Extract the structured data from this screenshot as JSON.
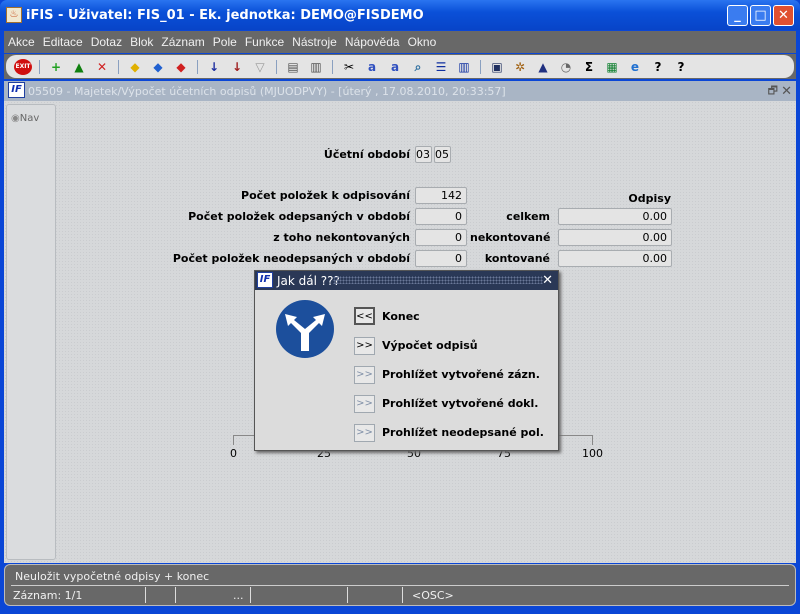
{
  "window": {
    "title": "iFIS - Uživatel: FIS_01 - Ek. jednotka: DEMO@FISDEMO"
  },
  "menu": [
    "Akce",
    "Editace",
    "Dotaz",
    "Blok",
    "Záznam",
    "Pole",
    "Funkce",
    "Nástroje",
    "Nápověda",
    "Okno"
  ],
  "toolbar": {
    "exit_label": "EXIT",
    "icons": [
      "insert-record-icon",
      "lock-record-icon",
      "delete-record-icon",
      "query-icon",
      "execute-query-icon",
      "cancel-query-icon",
      "sort-asc-icon",
      "sort-desc-icon",
      "filter-icon",
      "print-icon",
      "print-setup-icon",
      "cut-icon",
      "copy-icon",
      "paste-icon",
      "search-icon",
      "indent-icon",
      "columns-icon",
      "export-icon",
      "settings-icon",
      "triangle-icon",
      "calculator-icon",
      "sum-icon",
      "excel-icon",
      "internet-icon",
      "help-icon",
      "context-help-icon"
    ]
  },
  "form": {
    "title": "05509 - Majetek/Výpočet účetních odpisů (MJUODPVY) - [úterý  , 17.08.2010, 20:33:57]",
    "nav": "Nav",
    "period_label": "Účetní období",
    "period_month": "03",
    "period_year": "05",
    "rows": [
      {
        "label": "Počet položek k odpisování",
        "value": "142"
      },
      {
        "label": "Počet položek odepsaných v období",
        "value": "0"
      },
      {
        "label": "z toho nekontovaných",
        "value": "0"
      },
      {
        "label": "Počet položek neodepsaných v období",
        "value": "0"
      }
    ],
    "odpisy_header": "Odpisy",
    "odpisy": [
      {
        "label": "celkem",
        "value": "0.00"
      },
      {
        "label": "nekontované",
        "value": "0.00"
      },
      {
        "label": "kontované",
        "value": "0.00"
      }
    ],
    "scale": [
      "0",
      "25",
      "50",
      "75",
      "100"
    ]
  },
  "dialog": {
    "title": "Jak dál ???",
    "close": "✕",
    "options": [
      {
        "btn": "<<",
        "label": "Konec"
      },
      {
        "btn": ">>",
        "label": "Výpočet odpisů"
      },
      {
        "btn": ">>",
        "label": "Prohlížet vytvořené zázn."
      },
      {
        "btn": ">>",
        "label": "Prohlížet vytvořené dokl."
      },
      {
        "btn": ">>",
        "label": "Prohlížet neodepsané pol."
      }
    ]
  },
  "status": {
    "message": "Neuložit vypočetné odpisy + konec",
    "record": "Záznam: 1/1",
    "ellipsis": "...",
    "mode": "<OSC>"
  }
}
